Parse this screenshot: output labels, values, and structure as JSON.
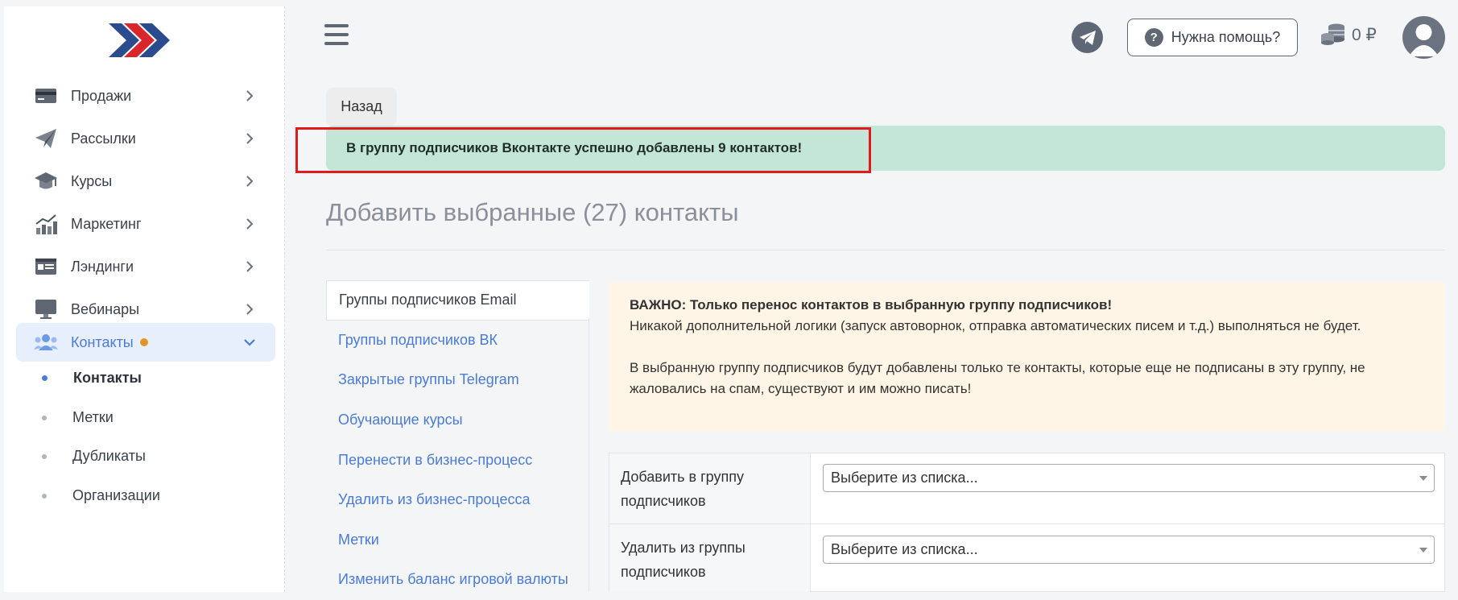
{
  "sidebar": {
    "items": [
      {
        "label": "Продажи",
        "icon": "card-icon"
      },
      {
        "label": "Рассылки",
        "icon": "paper-plane-icon"
      },
      {
        "label": "Курсы",
        "icon": "graduation-cap-icon"
      },
      {
        "label": "Маркетинг",
        "icon": "chart-icon"
      },
      {
        "label": "Лэндинги",
        "icon": "landing-icon"
      },
      {
        "label": "Вебинары",
        "icon": "monitor-icon"
      },
      {
        "label": "Контакты",
        "icon": "users-icon"
      }
    ],
    "subitems": [
      {
        "label": "Контакты"
      },
      {
        "label": "Метки"
      },
      {
        "label": "Дубликаты"
      },
      {
        "label": "Организации"
      }
    ]
  },
  "header": {
    "help_label": "Нужна помощь?",
    "help_icon_glyph": "?",
    "balance": "0 ₽"
  },
  "main": {
    "back_label": "Назад",
    "success_message": "В группу подписчиков Вконтакте успешно добавлены 9 контактов!",
    "page_title": "Добавить выбранные (27) контакты",
    "tabs": [
      {
        "label": "Группы подписчиков Email"
      },
      {
        "label": "Группы подписчиков ВК"
      },
      {
        "label": "Закрытые группы Telegram"
      },
      {
        "label": "Обучающие курсы"
      },
      {
        "label": "Перенести в бизнес-процесс"
      },
      {
        "label": "Удалить из бизнес-процесса"
      },
      {
        "label": "Метки"
      },
      {
        "label": "Изменить баланс игровой валюты"
      }
    ],
    "notice": {
      "title": "ВАЖНО: Только перенос контактов в выбранную группу подписчиков!",
      "line1": "Никакой дополнительной логики (запуск автоворнок, отправка автоматических писем и т.д.) выполняться не будет.",
      "line2": "В выбранную группу подписчиков будут добавлены только те контакты, которые еще не подписаны в эту группу, не жаловались на спам, существуют и им можно писать!"
    },
    "form": {
      "rows": [
        {
          "label": "Добавить в группу подписчиков",
          "select_value": "Выберите из списка..."
        },
        {
          "label": "Удалить из группы подписчиков",
          "select_value": "Выберите из списка..."
        }
      ]
    }
  },
  "colors": {
    "accent": "#4a7bd6",
    "success_bg": "#c3e6d8",
    "notice_bg": "#fff5e6",
    "highlight": "#e01b1b",
    "badge": "#e0952a"
  }
}
